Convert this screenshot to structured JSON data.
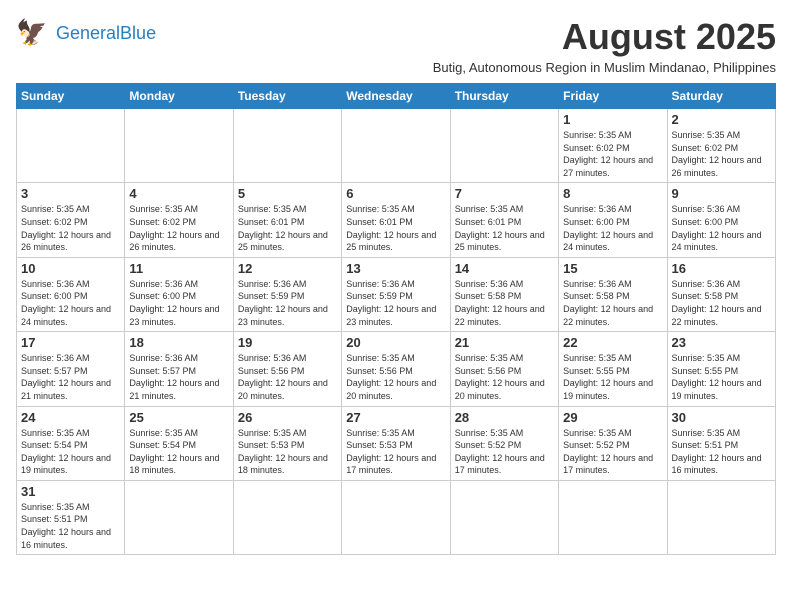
{
  "logo": {
    "general": "General",
    "blue": "Blue"
  },
  "title": "August 2025",
  "subtitle": "Butig, Autonomous Region in Muslim Mindanao, Philippines",
  "weekdays": [
    "Sunday",
    "Monday",
    "Tuesday",
    "Wednesday",
    "Thursday",
    "Friday",
    "Saturday"
  ],
  "weeks": [
    [
      {
        "day": "",
        "info": ""
      },
      {
        "day": "",
        "info": ""
      },
      {
        "day": "",
        "info": ""
      },
      {
        "day": "",
        "info": ""
      },
      {
        "day": "",
        "info": ""
      },
      {
        "day": "1",
        "info": "Sunrise: 5:35 AM\nSunset: 6:02 PM\nDaylight: 12 hours and 27 minutes."
      },
      {
        "day": "2",
        "info": "Sunrise: 5:35 AM\nSunset: 6:02 PM\nDaylight: 12 hours and 26 minutes."
      }
    ],
    [
      {
        "day": "3",
        "info": "Sunrise: 5:35 AM\nSunset: 6:02 PM\nDaylight: 12 hours and 26 minutes."
      },
      {
        "day": "4",
        "info": "Sunrise: 5:35 AM\nSunset: 6:02 PM\nDaylight: 12 hours and 26 minutes."
      },
      {
        "day": "5",
        "info": "Sunrise: 5:35 AM\nSunset: 6:01 PM\nDaylight: 12 hours and 25 minutes."
      },
      {
        "day": "6",
        "info": "Sunrise: 5:35 AM\nSunset: 6:01 PM\nDaylight: 12 hours and 25 minutes."
      },
      {
        "day": "7",
        "info": "Sunrise: 5:35 AM\nSunset: 6:01 PM\nDaylight: 12 hours and 25 minutes."
      },
      {
        "day": "8",
        "info": "Sunrise: 5:36 AM\nSunset: 6:00 PM\nDaylight: 12 hours and 24 minutes."
      },
      {
        "day": "9",
        "info": "Sunrise: 5:36 AM\nSunset: 6:00 PM\nDaylight: 12 hours and 24 minutes."
      }
    ],
    [
      {
        "day": "10",
        "info": "Sunrise: 5:36 AM\nSunset: 6:00 PM\nDaylight: 12 hours and 24 minutes."
      },
      {
        "day": "11",
        "info": "Sunrise: 5:36 AM\nSunset: 6:00 PM\nDaylight: 12 hours and 23 minutes."
      },
      {
        "day": "12",
        "info": "Sunrise: 5:36 AM\nSunset: 5:59 PM\nDaylight: 12 hours and 23 minutes."
      },
      {
        "day": "13",
        "info": "Sunrise: 5:36 AM\nSunset: 5:59 PM\nDaylight: 12 hours and 23 minutes."
      },
      {
        "day": "14",
        "info": "Sunrise: 5:36 AM\nSunset: 5:58 PM\nDaylight: 12 hours and 22 minutes."
      },
      {
        "day": "15",
        "info": "Sunrise: 5:36 AM\nSunset: 5:58 PM\nDaylight: 12 hours and 22 minutes."
      },
      {
        "day": "16",
        "info": "Sunrise: 5:36 AM\nSunset: 5:58 PM\nDaylight: 12 hours and 22 minutes."
      }
    ],
    [
      {
        "day": "17",
        "info": "Sunrise: 5:36 AM\nSunset: 5:57 PM\nDaylight: 12 hours and 21 minutes."
      },
      {
        "day": "18",
        "info": "Sunrise: 5:36 AM\nSunset: 5:57 PM\nDaylight: 12 hours and 21 minutes."
      },
      {
        "day": "19",
        "info": "Sunrise: 5:36 AM\nSunset: 5:56 PM\nDaylight: 12 hours and 20 minutes."
      },
      {
        "day": "20",
        "info": "Sunrise: 5:35 AM\nSunset: 5:56 PM\nDaylight: 12 hours and 20 minutes."
      },
      {
        "day": "21",
        "info": "Sunrise: 5:35 AM\nSunset: 5:56 PM\nDaylight: 12 hours and 20 minutes."
      },
      {
        "day": "22",
        "info": "Sunrise: 5:35 AM\nSunset: 5:55 PM\nDaylight: 12 hours and 19 minutes."
      },
      {
        "day": "23",
        "info": "Sunrise: 5:35 AM\nSunset: 5:55 PM\nDaylight: 12 hours and 19 minutes."
      }
    ],
    [
      {
        "day": "24",
        "info": "Sunrise: 5:35 AM\nSunset: 5:54 PM\nDaylight: 12 hours and 19 minutes."
      },
      {
        "day": "25",
        "info": "Sunrise: 5:35 AM\nSunset: 5:54 PM\nDaylight: 12 hours and 18 minutes."
      },
      {
        "day": "26",
        "info": "Sunrise: 5:35 AM\nSunset: 5:53 PM\nDaylight: 12 hours and 18 minutes."
      },
      {
        "day": "27",
        "info": "Sunrise: 5:35 AM\nSunset: 5:53 PM\nDaylight: 12 hours and 17 minutes."
      },
      {
        "day": "28",
        "info": "Sunrise: 5:35 AM\nSunset: 5:52 PM\nDaylight: 12 hours and 17 minutes."
      },
      {
        "day": "29",
        "info": "Sunrise: 5:35 AM\nSunset: 5:52 PM\nDaylight: 12 hours and 17 minutes."
      },
      {
        "day": "30",
        "info": "Sunrise: 5:35 AM\nSunset: 5:51 PM\nDaylight: 12 hours and 16 minutes."
      }
    ],
    [
      {
        "day": "31",
        "info": "Sunrise: 5:35 AM\nSunset: 5:51 PM\nDaylight: 12 hours and 16 minutes."
      },
      {
        "day": "",
        "info": ""
      },
      {
        "day": "",
        "info": ""
      },
      {
        "day": "",
        "info": ""
      },
      {
        "day": "",
        "info": ""
      },
      {
        "day": "",
        "info": ""
      },
      {
        "day": "",
        "info": ""
      }
    ]
  ]
}
